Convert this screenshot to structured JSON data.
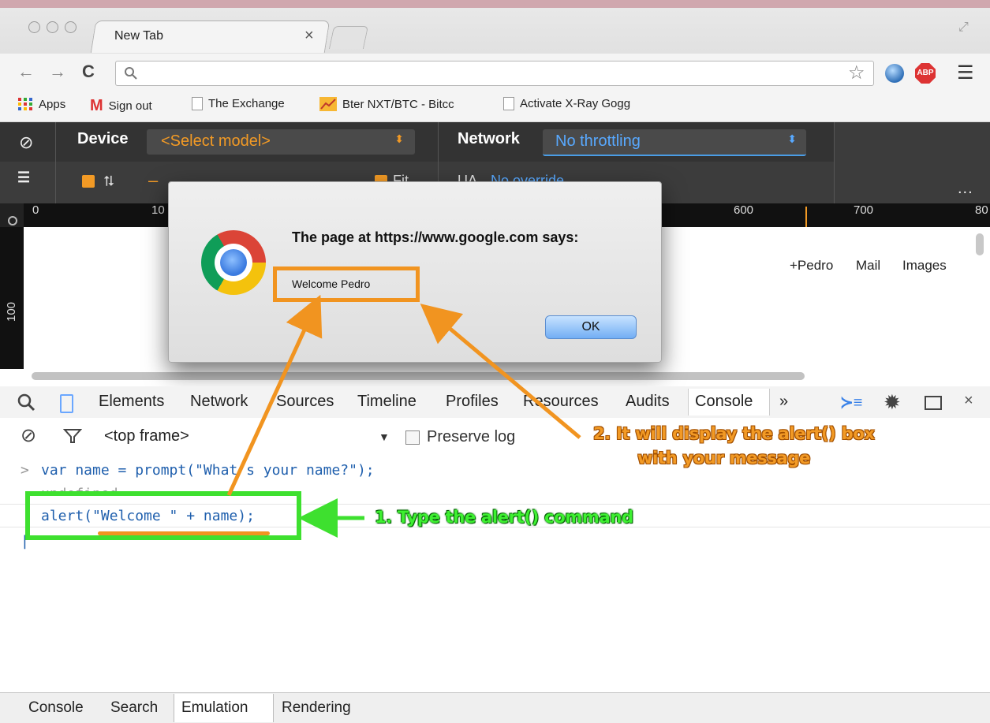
{
  "browser": {
    "tab_title": "New Tab",
    "tab_close": "×",
    "bookmarks": [
      {
        "label": "Apps"
      },
      {
        "label": "Sign out"
      },
      {
        "label": "The Exchange"
      },
      {
        "label": "Bter NXT/BTC - Bitcc"
      },
      {
        "label": "Activate X-Ray Gogg"
      }
    ]
  },
  "emulation": {
    "device_label": "Device",
    "device_value": "<Select model>",
    "network_label": "Network",
    "network_value": "No throttling",
    "ua_label": "UA",
    "ua_value": "No override",
    "fit_label": "Fit",
    "ruler_top": [
      "0",
      "10",
      "600",
      "700",
      "80"
    ],
    "ruler_left": "100",
    "more": "..."
  },
  "page": {
    "links": [
      "+Pedro",
      "Mail",
      "Images"
    ]
  },
  "dialog": {
    "title": "The page at https://www.google.com says:",
    "message": "Welcome Pedro",
    "ok_label": "OK"
  },
  "devtools": {
    "tabs": [
      "Elements",
      "Network",
      "Sources",
      "Timeline",
      "Profiles",
      "Resources",
      "Audits",
      "Console"
    ],
    "more_tabs": "»",
    "frame_select": "<top frame>",
    "preserve_log": "Preserve log",
    "console_lines": [
      "var name = prompt(\"What’s your name?\");",
      "undefined",
      "alert(\"Welcome \" + name);"
    ],
    "bottom_tabs": [
      "Console",
      "Search",
      "Emulation",
      "Rendering"
    ]
  },
  "annotations": {
    "step1": "1. Type the alert() command",
    "step2_line1": "2. It will display the alert() box",
    "step2_line2": "with your message"
  },
  "colors": {
    "annotation_orange": "#f19420",
    "annotation_green": "#3ee02f",
    "console_blue": "#1f5fad",
    "emulation_dark": "#3c3c3c"
  }
}
